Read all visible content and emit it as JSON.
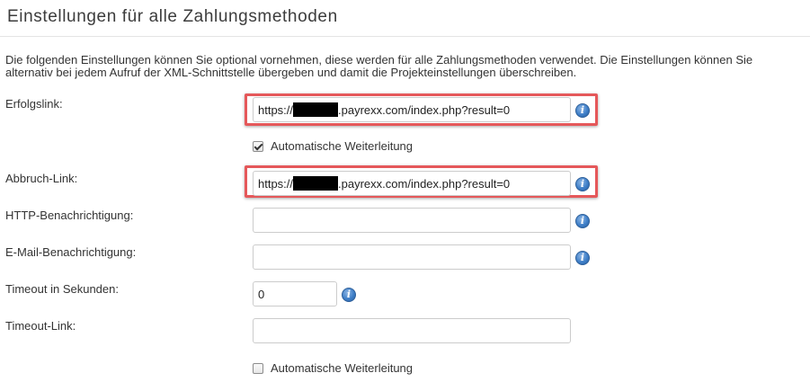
{
  "page": {
    "title": "Einstellungen für alle Zahlungsmethoden",
    "intro": "Die folgenden Einstellungen können Sie optional vornehmen, diese werden für alle Zahlungsmethoden verwendet. Die Einstellungen können Sie alternativ bei jedem Aufruf der XML-Schnittstelle übergeben und damit die Projekteinstellungen überschreiben."
  },
  "form": {
    "erfolgslink": {
      "label": "Erfolgslink:",
      "value_prefix": "https://",
      "value_suffix": ".payrexx.com/index.php?result=0",
      "info_icon": "info-icon",
      "highlighted": true
    },
    "erfolgslink_redirect": {
      "label": "Automatische Weiterleitung",
      "checked": true
    },
    "abbruch_link": {
      "label": "Abbruch-Link:",
      "value_prefix": "https://",
      "value_suffix": ".payrexx.com/index.php?result=0",
      "info_icon": "info-icon",
      "highlighted": true
    },
    "http_notification": {
      "label": "HTTP-Benachrichtigung:",
      "value": "",
      "info_icon": "info-icon"
    },
    "email_notification": {
      "label": "E-Mail-Benachrichtigung:",
      "value": "",
      "info_icon": "info-icon"
    },
    "timeout": {
      "label": "Timeout in Sekunden:",
      "value": "0",
      "info_icon": "info-icon"
    },
    "timeout_link": {
      "label": "Timeout-Link:",
      "value": ""
    },
    "timeout_redirect": {
      "label": "Automatische Weiterleitung",
      "checked": false
    }
  },
  "colors": {
    "highlight_border": "#e5585a",
    "info_icon": "#3f7fc8",
    "redaction": "#000000"
  }
}
